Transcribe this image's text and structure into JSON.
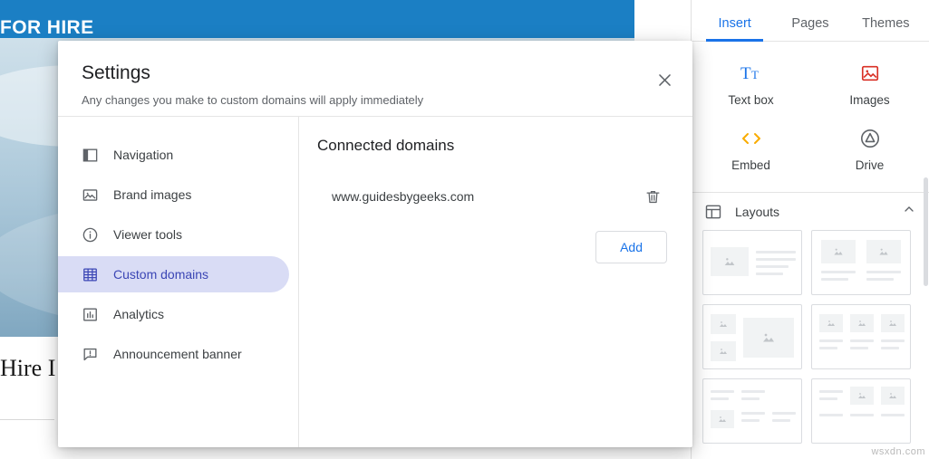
{
  "site": {
    "header_title": "FOR HIRE",
    "body_heading": "Hire I"
  },
  "right_panel": {
    "tabs": [
      {
        "label": "Insert",
        "active": true
      },
      {
        "label": "Pages",
        "active": false
      },
      {
        "label": "Themes",
        "active": false
      }
    ],
    "insert_items": [
      {
        "label": "Text box",
        "icon": "text-box-icon"
      },
      {
        "label": "Images",
        "icon": "images-icon"
      },
      {
        "label": "Embed",
        "icon": "embed-code-icon"
      },
      {
        "label": "Drive",
        "icon": "drive-icon"
      }
    ],
    "layouts_section": {
      "title": "Layouts",
      "icon": "layouts-grid-icon",
      "collapse_icon": "chevron-up-icon"
    }
  },
  "dialog": {
    "title": "Settings",
    "subtitle": "Any changes you make to custom domains will apply immediately",
    "close_icon": "close-icon",
    "nav_items": [
      {
        "label": "Navigation",
        "icon": "navigation-icon",
        "active": false
      },
      {
        "label": "Brand images",
        "icon": "brand-images-icon",
        "active": false
      },
      {
        "label": "Viewer tools",
        "icon": "info-circle-icon",
        "active": false
      },
      {
        "label": "Custom domains",
        "icon": "domains-building-icon",
        "active": true
      },
      {
        "label": "Analytics",
        "icon": "analytics-bars-icon",
        "active": false
      },
      {
        "label": "Announcement banner",
        "icon": "announcement-icon",
        "active": false
      }
    ],
    "content": {
      "heading": "Connected domains",
      "domain": "www.guidesbygeeks.com",
      "delete_icon": "trash-icon",
      "add_label": "Add"
    }
  },
  "watermark": "wsxdn.com",
  "colors": {
    "accent_blue": "#1a73e8",
    "site_header_blue": "#1b7fc4",
    "nav_active_bg": "#d9dcf5",
    "nav_active_fg": "#3b46b5"
  }
}
